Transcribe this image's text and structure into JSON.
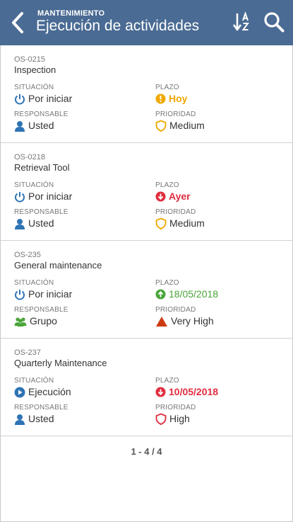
{
  "header": {
    "subtitle": "MANTENIMIENTO",
    "title": "Ejecución de actividades",
    "back_icon": "chevron-left-icon",
    "sort_icon": "sort-az-icon",
    "search_icon": "search-icon",
    "background": "#4a6b93"
  },
  "labels": {
    "situacion": "SITUACIÓN",
    "plazo": "PLAZO",
    "responsable": "RESPONSABLE",
    "prioridad": "PRIORIDAD"
  },
  "colors": {
    "orange": "#f0a800",
    "red": "#e02d3f",
    "green": "#4aa53a",
    "blue": "#2e74b5"
  },
  "items": [
    {
      "code": "OS-0215",
      "name": "Inspection",
      "situacion": "Por iniciar",
      "situacion_icon": "power-icon",
      "plazo": "Hoy",
      "plazo_icon": "warning-circle-icon",
      "responsable": "Usted",
      "responsable_icon": "user-icon",
      "prioridad": "Medium",
      "prioridad_icon": "shield-icon"
    },
    {
      "code": "OS-0218",
      "name": "Retrieval Tool",
      "situacion": "Por iniciar",
      "situacion_icon": "power-icon",
      "plazo": "Ayer",
      "plazo_icon": "arrow-down-circle-icon",
      "responsable": "Usted",
      "responsable_icon": "user-icon",
      "prioridad": "Medium",
      "prioridad_icon": "shield-icon"
    },
    {
      "code": "OS-235",
      "name": "General maintenance",
      "situacion": "Por iniciar",
      "situacion_icon": "power-icon",
      "plazo": "18/05/2018",
      "plazo_icon": "arrow-up-circle-icon",
      "responsable": "Grupo",
      "responsable_icon": "group-icon",
      "prioridad": "Very High",
      "prioridad_icon": "triangle-icon"
    },
    {
      "code": "OS-237",
      "name": "Quarterly Maintenance",
      "situacion": "Ejecución",
      "situacion_icon": "play-circle-icon",
      "plazo": "10/05/2018",
      "plazo_icon": "arrow-down-circle-icon",
      "responsable": "Usted",
      "responsable_icon": "user-icon",
      "prioridad": "High",
      "prioridad_icon": "shield-icon"
    }
  ],
  "pager": {
    "text": "1 - 4 / 4"
  }
}
